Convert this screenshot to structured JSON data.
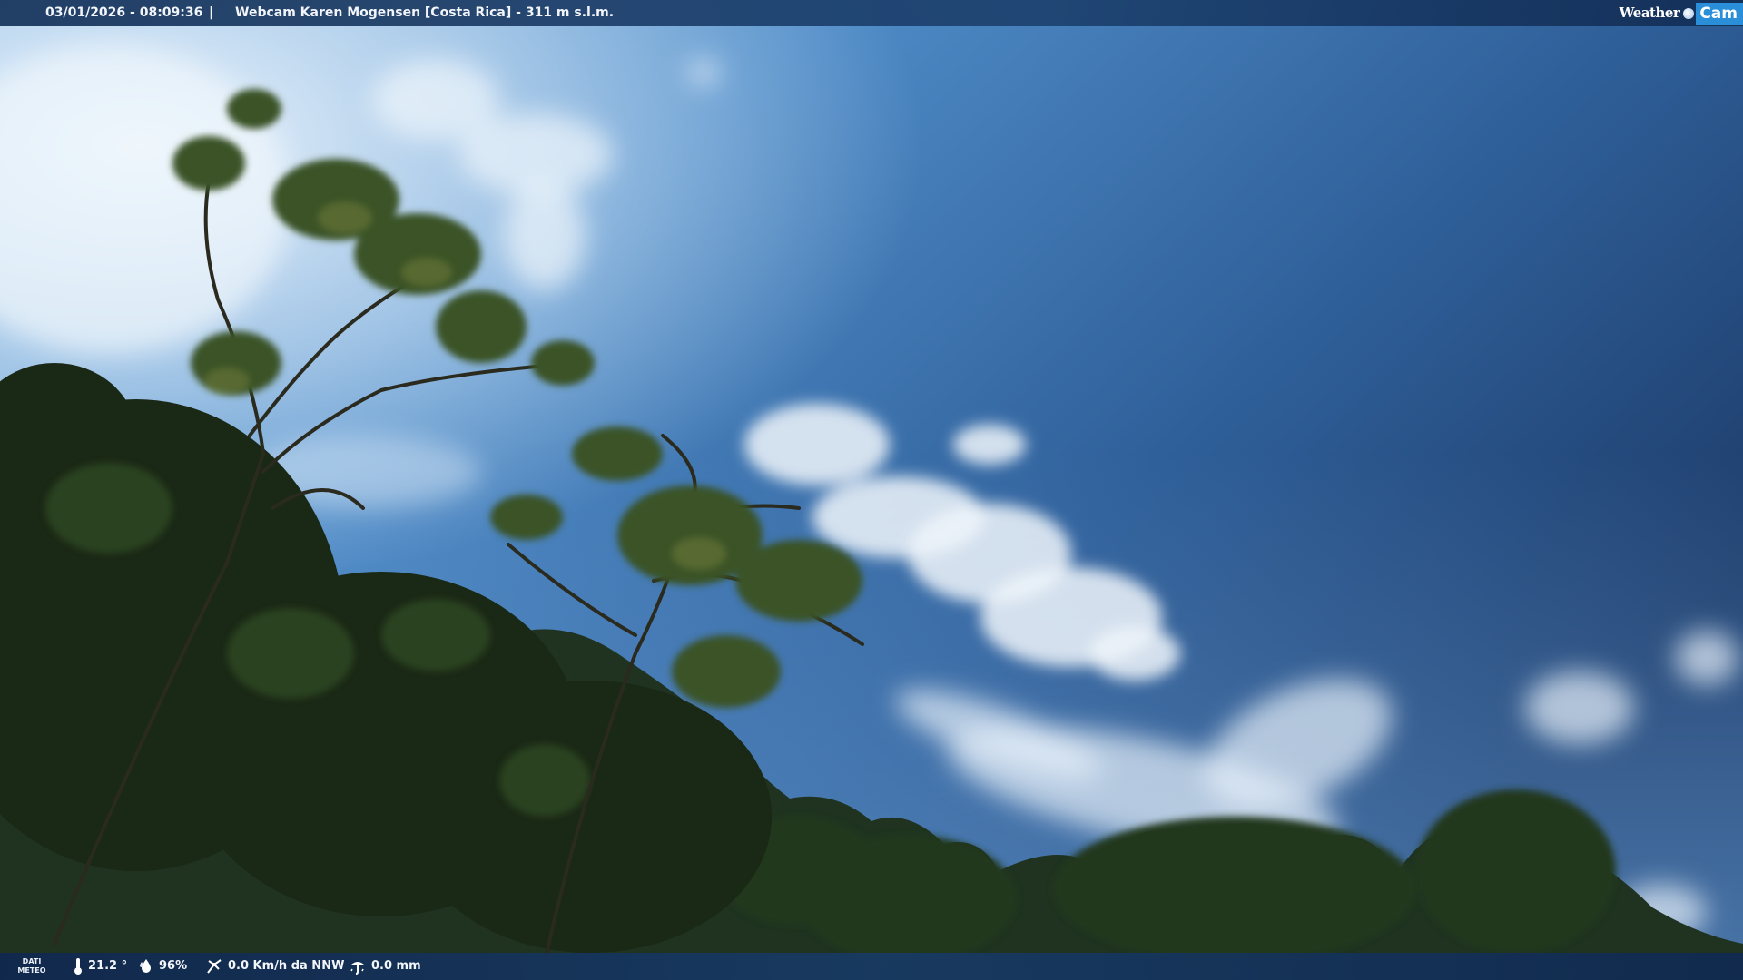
{
  "header": {
    "datetime": "03/01/2026 - 08:09:36",
    "separator": "|",
    "title": "Webcam Karen Mogensen [Costa Rica]  - 311 m s.l.m."
  },
  "logo": {
    "part1": "Weather",
    "part2": "Cam"
  },
  "meteo": {
    "label_line1": "DATI",
    "label_line2": "METEO",
    "temperature": "21.2 °",
    "humidity": "96%",
    "wind": "0.0 Km/h da NNW",
    "rain": "0.0 mm"
  },
  "icons": [
    "thermometer-icon",
    "humidity-drop-icon",
    "wind-icon",
    "rain-gauge-icon"
  ],
  "colors": {
    "bar_background": "#173a6a",
    "logo_accent": "#2a8fd8",
    "sky_top": "#1d3e6b",
    "sky_light": "#6aa4d8",
    "vegetation": "#1a2a18"
  }
}
